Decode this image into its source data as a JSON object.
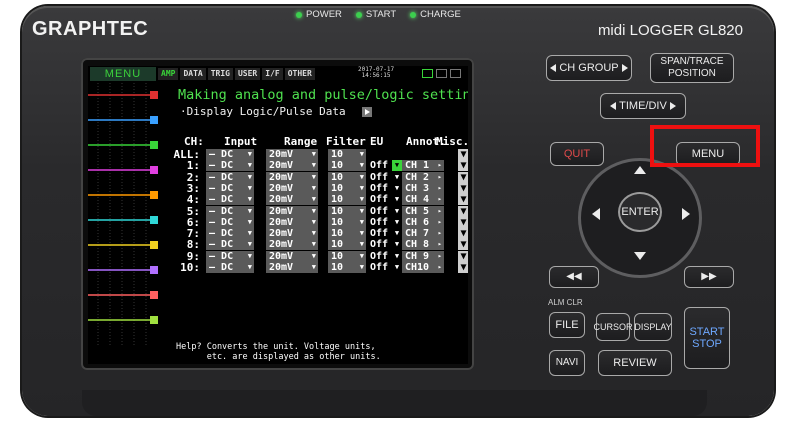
{
  "device": {
    "brand": "GRAPHTEC",
    "model": "midi LOGGER GL820",
    "leds": [
      {
        "label": "POWER"
      },
      {
        "label": "START"
      },
      {
        "label": "CHARGE"
      }
    ]
  },
  "screen": {
    "menu_label": "MENU",
    "tabs": [
      "AMP",
      "DATA",
      "TRIG",
      "USER",
      "I/F",
      "OTHER"
    ],
    "active_tab": "AMP",
    "date": "2017-07-17",
    "time": "14:56:15",
    "title": "Making analog and pulse/logic settings",
    "subtitle": "·Display Logic/Pulse Data",
    "headers": {
      "ch": "CH:",
      "input": "Input",
      "range": "Range",
      "filter": "Filter",
      "eu": "EU",
      "annot": "Annot.",
      "misc": "Misc."
    },
    "all_row": {
      "ch": "ALL:",
      "input": "DC",
      "range": "20mV",
      "filter": "10"
    },
    "rows": [
      {
        "ch": "1:",
        "input": "DC",
        "range": "20mV",
        "filter": "10",
        "eu": "Off",
        "annot": "CH 1"
      },
      {
        "ch": "2:",
        "input": "DC",
        "range": "20mV",
        "filter": "10",
        "eu": "Off",
        "annot": "CH 2"
      },
      {
        "ch": "3:",
        "input": "DC",
        "range": "20mV",
        "filter": "10",
        "eu": "Off",
        "annot": "CH 3"
      },
      {
        "ch": "4:",
        "input": "DC",
        "range": "20mV",
        "filter": "10",
        "eu": "Off",
        "annot": "CH 4"
      },
      {
        "ch": "5:",
        "input": "DC",
        "range": "20mV",
        "filter": "10",
        "eu": "Off",
        "annot": "CH 5"
      },
      {
        "ch": "6:",
        "input": "DC",
        "range": "20mV",
        "filter": "10",
        "eu": "Off",
        "annot": "CH 6"
      },
      {
        "ch": "7:",
        "input": "DC",
        "range": "20mV",
        "filter": "10",
        "eu": "Off",
        "annot": "CH 7"
      },
      {
        "ch": "8:",
        "input": "DC",
        "range": "20mV",
        "filter": "10",
        "eu": "Off",
        "annot": "CH 8"
      },
      {
        "ch": "9:",
        "input": "DC",
        "range": "20mV",
        "filter": "10",
        "eu": "Off",
        "annot": "CH 9"
      },
      {
        "ch": "10:",
        "input": "DC",
        "range": "20mV",
        "filter": "10",
        "eu": "Off",
        "annot": "CH10"
      }
    ],
    "help_line1": "Help? Converts the unit. Voltage units,",
    "help_line2": "      etc. are displayed as other units.",
    "trace_colors": [
      "#e03030",
      "#3aa0ff",
      "#39d339",
      "#e040e0",
      "#ff9900",
      "#30d8d8",
      "#f0d020",
      "#b070ff",
      "#ff6060",
      "#a0e040"
    ]
  },
  "buttons": {
    "ch_group": "CH GROUP",
    "span_trace_line1": "SPAN/TRACE",
    "span_trace_line2": "POSITION",
    "time_div": "TIME/DIV",
    "quit": "QUIT",
    "menu": "MENU",
    "enter": "ENTER",
    "rewind": "◀◀",
    "forward": "▶▶",
    "alm_cur": "ALM CLR",
    "file": "FILE",
    "cursor": "CURSOR",
    "display": "DISPLAY",
    "start_stop_line1": "START",
    "start_stop_line2": "STOP",
    "navi": "NAVI",
    "review": "REVIEW"
  },
  "highlight_color": "#ee1010"
}
